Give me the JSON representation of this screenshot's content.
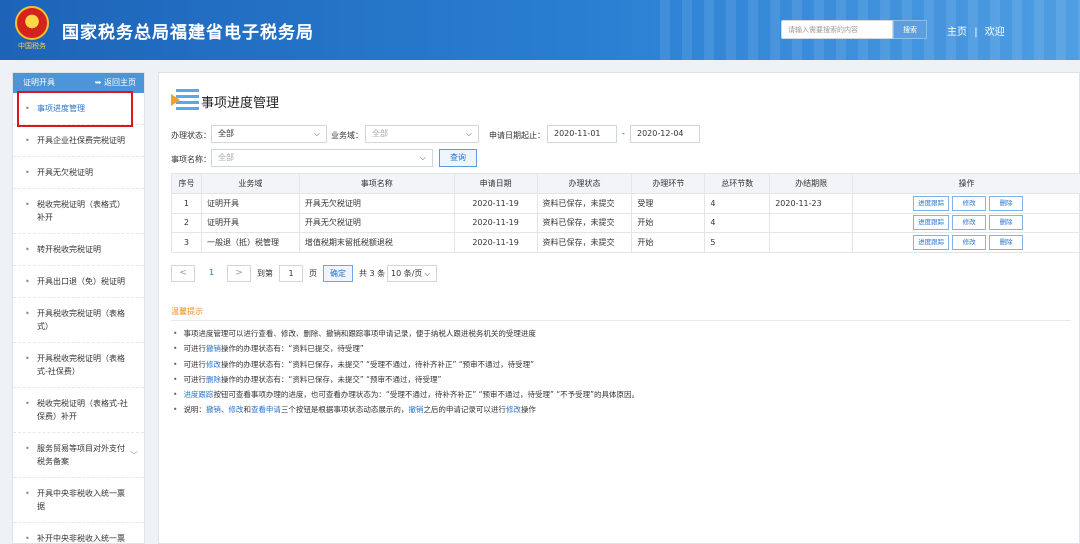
{
  "header": {
    "title": "国家税务总局福建省电子税务局",
    "emblem_text": "中国税务",
    "search_placeholder": "请输入需要搜索的内容",
    "search_button": "搜索",
    "nav_home": "主页",
    "nav_sep": "|",
    "nav_welcome": "欢迎"
  },
  "sidebar": {
    "section_title": "证明开具",
    "back_label": "返回主页",
    "items": [
      {
        "label": "事项进度管理",
        "active": true
      },
      {
        "label": "开具企业社保费完税证明"
      },
      {
        "label": "开具无欠税证明"
      },
      {
        "label": "税收完税证明（表格式）补开"
      },
      {
        "label": "转开税收完税证明"
      },
      {
        "label": "开具出口退（免）税证明"
      },
      {
        "label": "开具税收完税证明（表格式）"
      },
      {
        "label": "开具税收完税证明（表格式-社保费）"
      },
      {
        "label": "税收完税证明（表格式-社保费）补开"
      },
      {
        "label": "服务贸易等项目对外支付税务备案"
      },
      {
        "label": "开具中央非税收入统一票据"
      },
      {
        "label": "补开中央非税收入统一票据"
      }
    ]
  },
  "main": {
    "page_title": "事项进度管理",
    "filters": {
      "status_label": "办理状态：",
      "status_value": "全部",
      "domain_label": "业务域：",
      "domain_value": "全部",
      "date_label": "申请日期起止：",
      "date_from": "2020-11-01",
      "date_sep": "-",
      "date_to": "2020-12-04",
      "item_label": "事项名称：",
      "item_value": "全部",
      "query_button": "查询"
    },
    "table": {
      "columns": [
        "序号",
        "业务域",
        "事项名称",
        "申请日期",
        "办理状态",
        "办理环节",
        "总环节数",
        "办结期限",
        "操作"
      ],
      "rows": [
        {
          "no": "1",
          "domain": "证明开具",
          "name": "开具无欠税证明",
          "date": "2020-11-19",
          "status": "资料已保存，未提交",
          "step": "受理",
          "total": "4",
          "deadline": "2020-11-23"
        },
        {
          "no": "2",
          "domain": "证明开具",
          "name": "开具无欠税证明",
          "date": "2020-11-19",
          "status": "资料已保存，未提交",
          "step": "开始",
          "total": "4",
          "deadline": ""
        },
        {
          "no": "3",
          "domain": "一般退（抵）税管理",
          "name": "增值税期末留抵税额退税",
          "date": "2020-11-19",
          "status": "资料已保存，未提交",
          "step": "开始",
          "total": "5",
          "deadline": ""
        }
      ],
      "op_track": "进度跟踪",
      "op_edit": "修改",
      "op_delete": "删除"
    },
    "pager": {
      "prev": "<",
      "current_page": "1",
      "next": ">",
      "goto_label": "到第",
      "goto_value": "1",
      "page_unit": "页",
      "confirm": "确定",
      "total_text": "共 3 条",
      "page_size": "10 条/页"
    },
    "tips": {
      "title": "温馨提示",
      "lines": [
        [
          {
            "t": "事项进度管理可以进行查看、修改、删除、撤销和跟踪事项申请记录，便于纳税人跟进税务机关的受理进度"
          }
        ],
        [
          {
            "t": "可进行"
          },
          {
            "t": "撤销",
            "link": true
          },
          {
            "t": "操作的办理状态有：“资料已提交，待受理”"
          }
        ],
        [
          {
            "t": "可进行"
          },
          {
            "t": "修改",
            "link": true
          },
          {
            "t": "操作的办理状态有：“资料已保存，未提交”  “受理不通过，待补齐补正”  “预审不通过，待受理”"
          }
        ],
        [
          {
            "t": "可进行"
          },
          {
            "t": "删除",
            "link": true
          },
          {
            "t": "操作的办理状态有：“资料已保存，未提交”  “预审不通过，待受理”"
          }
        ],
        [
          {
            "t": "进度跟踪",
            "link": true
          },
          {
            "t": "按钮可查看事项办理的进度，也可查看办理状态为：“受理不通过，待补齐补正”  “预审不通过，待受理”  “不予受理”的具体原因。"
          }
        ],
        [
          {
            "t": "说明："
          },
          {
            "t": "撤销",
            "link": true
          },
          {
            "t": "、"
          },
          {
            "t": "修改",
            "link": true
          },
          {
            "t": "和"
          },
          {
            "t": "查看申请",
            "link": true
          },
          {
            "t": "三个按钮是根据事项状态动态展示的，"
          },
          {
            "t": "撤销",
            "link": true
          },
          {
            "t": "之后的申请记录可以进行"
          },
          {
            "t": "修改",
            "link": true
          },
          {
            "t": "操作"
          }
        ]
      ]
    }
  }
}
